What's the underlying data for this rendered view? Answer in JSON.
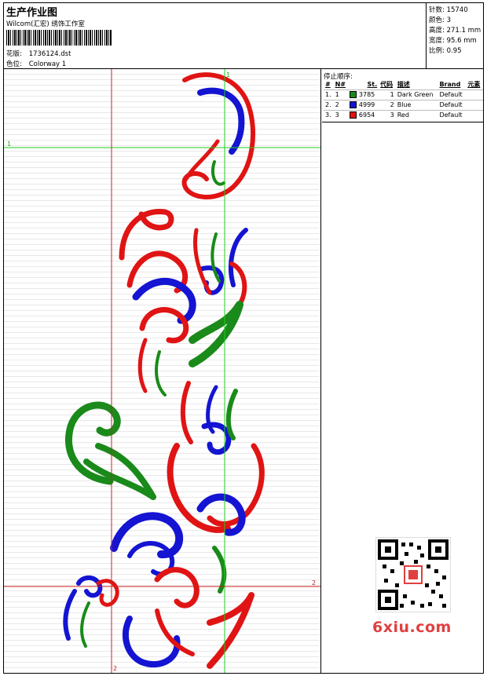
{
  "header": {
    "title": "生产作业图",
    "subtitle": "Wilcom(汇宏) 绣饰工作室",
    "design_label": "花版:",
    "design_value": "1736124.dst",
    "colorway_label": "色位:",
    "colorway_value": "Colorway 1"
  },
  "stats": {
    "stitches_label": "针数:",
    "stitches_value": "15740",
    "colors_label": "颜色:",
    "colors_value": "3",
    "height_label": "高度:",
    "height_value": "271.1 mm",
    "width_label": "宽度:",
    "width_value": "95.6 mm",
    "scale_label": "比例:",
    "scale_value": "0.95"
  },
  "color_table": {
    "title": "停止顺序:",
    "headers": [
      "#",
      "N#",
      "St.",
      "代码",
      "描述",
      "Brand",
      "元素"
    ],
    "rows": [
      {
        "num": "1.",
        "n": "1",
        "stitches": "3785",
        "code": "1",
        "desc": "Dark Green",
        "brand": "Default",
        "color": "#1a8a1a"
      },
      {
        "num": "2.",
        "n": "2",
        "stitches": "4999",
        "code": "2",
        "desc": "Blue",
        "brand": "Default",
        "color": "#1414d2"
      },
      {
        "num": "3.",
        "n": "3",
        "stitches": "6954",
        "code": "3",
        "desc": "Red",
        "brand": "Default",
        "color": "#e01414"
      }
    ]
  },
  "guides": {
    "vertical_1": "1",
    "vertical_2": "2",
    "horizontal_1": "1",
    "horizontal_2": "2"
  },
  "watermark": {
    "text": "6xiu.com"
  },
  "colors": {
    "green": "#1a8a1a",
    "blue": "#1414d2",
    "red": "#e01414",
    "guide_green": "#22cc22",
    "guide_red": "#cc2020"
  }
}
